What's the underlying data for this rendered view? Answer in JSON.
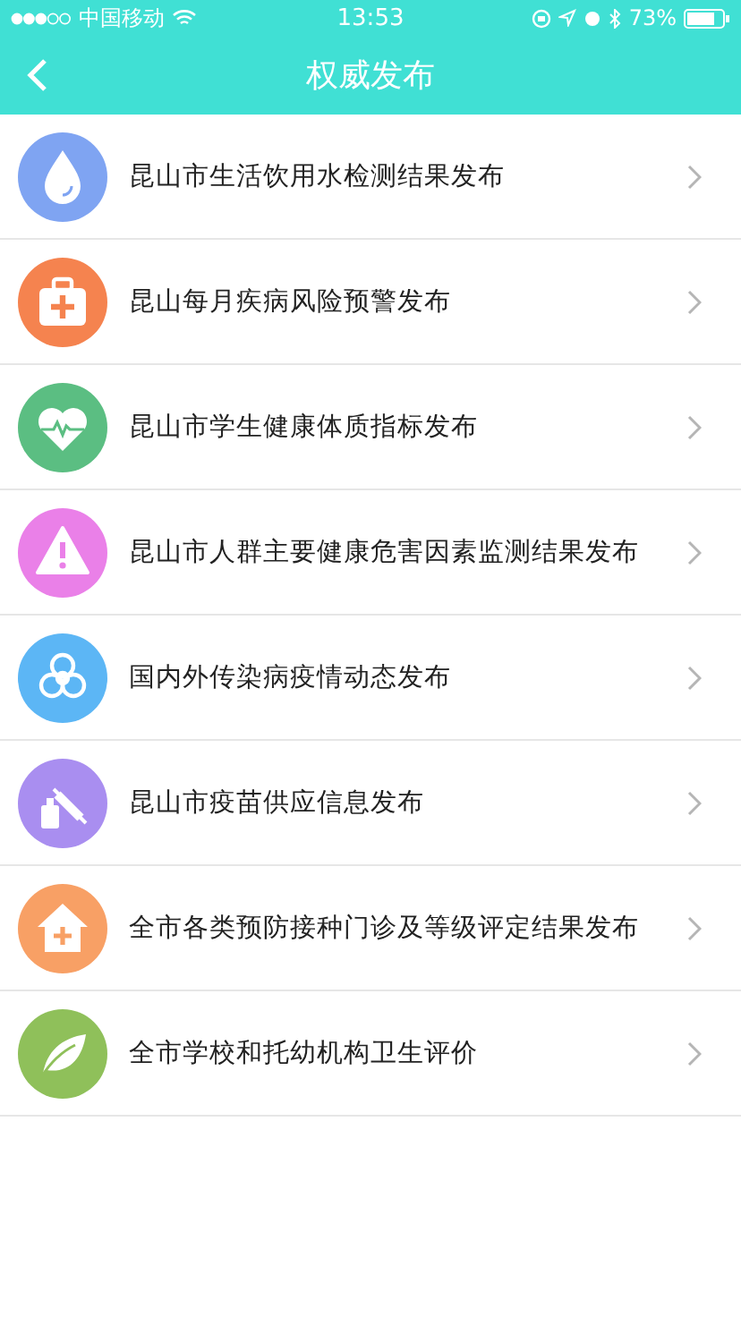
{
  "status_bar": {
    "carrier": "中国移动",
    "time": "13:53",
    "battery": "73%"
  },
  "nav_bar": {
    "title": "权威发布"
  },
  "items": [
    {
      "kind": "water",
      "color": "#7fa4f2",
      "label": "昆山市生活饮用水检测结果发布"
    },
    {
      "kind": "medkit",
      "color": "#f5834f",
      "label": "昆山每月疾病风险预警发布"
    },
    {
      "kind": "heart",
      "color": "#5bbe82",
      "label": "昆山市学生健康体质指标发布"
    },
    {
      "kind": "warning",
      "color": "#ea80e8",
      "label": "昆山市人群主要健康危害因素监测结果发布"
    },
    {
      "kind": "biohazard",
      "color": "#5cb6f5",
      "label": "国内外传染病疫情动态发布"
    },
    {
      "kind": "vaccine",
      "color": "#a98ef0",
      "label": "昆山市疫苗供应信息发布"
    },
    {
      "kind": "clinic",
      "color": "#f8a065",
      "label": "全市各类预防接种门诊及等级评定结果发布"
    },
    {
      "kind": "leaf",
      "color": "#8fc05a",
      "label": "全市学校和托幼机构卫生评价"
    }
  ]
}
